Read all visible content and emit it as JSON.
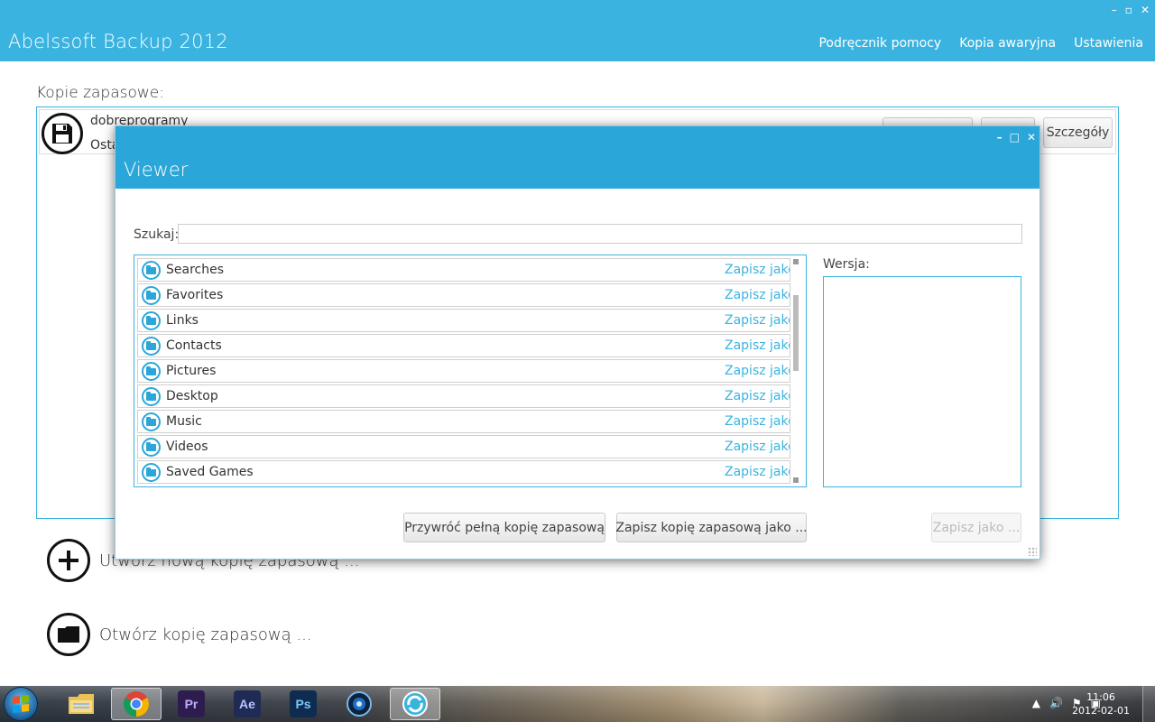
{
  "app": {
    "title": "Abelssoft Backup 2012",
    "nav": [
      "Podręcznik pomocy",
      "Kopia awaryjna",
      "Ustawienia"
    ],
    "window_controls": [
      "–",
      "▫",
      "✕"
    ]
  },
  "main": {
    "section_label": "Kopie zapasowe:",
    "backup_item": {
      "name": "dobreprogramy",
      "subtitle": "Osta",
      "details_button": "Szczegóły"
    },
    "actions": {
      "create_new": "Utwórz nową kopię zapasową ...",
      "open_existing": "Otwórz kopię zapasową ..."
    }
  },
  "viewer": {
    "title": "Viewer",
    "window_controls": [
      "–",
      "□",
      "✕"
    ],
    "search_label": "Szukaj:",
    "search_value": "",
    "version_label": "Wersja:",
    "items": [
      {
        "name": "Searches",
        "action": "Zapisz jako"
      },
      {
        "name": "Favorites",
        "action": "Zapisz jako"
      },
      {
        "name": "Links",
        "action": "Zapisz jako"
      },
      {
        "name": "Contacts",
        "action": "Zapisz jako"
      },
      {
        "name": "Pictures",
        "action": "Zapisz jako"
      },
      {
        "name": "Desktop",
        "action": "Zapisz jako"
      },
      {
        "name": "Music",
        "action": "Zapisz jako"
      },
      {
        "name": "Videos",
        "action": "Zapisz jako"
      },
      {
        "name": "Saved Games",
        "action": "Zapisz jako"
      }
    ],
    "buttons": {
      "restore_full": "Przywróć pełną kopię zapasową",
      "save_backup_as": "Zapisz kopię zapasową jako ...",
      "save_as": "Zapisz jako ..."
    },
    "save_as_enabled": false
  },
  "taskbar": {
    "apps": [
      {
        "name": "Windows Explorer",
        "icon": "folder-icon"
      },
      {
        "name": "Google Chrome",
        "icon": "chrome-icon"
      },
      {
        "name": "Adobe Premiere",
        "icon": "premiere-icon",
        "label": "Pr"
      },
      {
        "name": "After Effects",
        "icon": "after-effects-icon",
        "label": "Ae"
      },
      {
        "name": "Photoshop",
        "icon": "photoshop-icon",
        "label": "Ps"
      },
      {
        "name": "Media Player",
        "icon": "media-player-icon"
      },
      {
        "name": "Abelssoft Backup",
        "icon": "backup-app-icon"
      }
    ],
    "time": "11:06",
    "date": "2012-02-01",
    "colors": {
      "premiere": "#2d1d4f",
      "after_effects": "#1f2a55",
      "photoshop": "#0e2c4f"
    }
  },
  "colors": {
    "accent": "#3ab3e0",
    "viewer_header": "#2ba6d9",
    "link": "#3ab3e0"
  }
}
